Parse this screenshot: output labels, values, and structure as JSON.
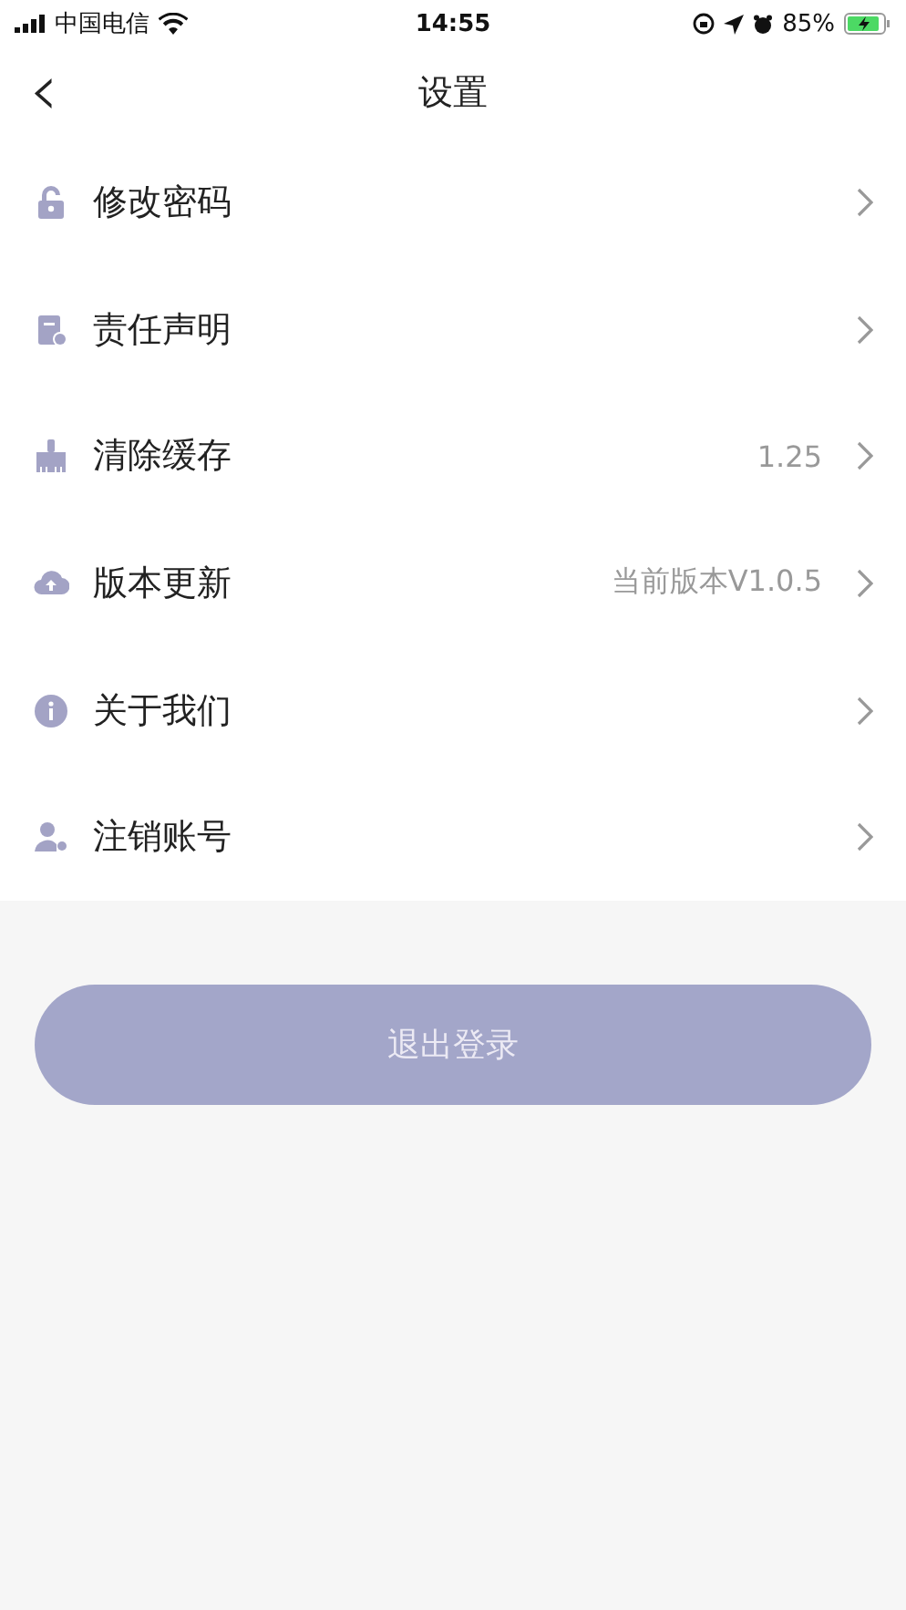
{
  "status_bar": {
    "carrier": "中国电信",
    "time": "14:55",
    "battery": "85%"
  },
  "header": {
    "back": "‹",
    "title": "设置"
  },
  "items": [
    {
      "kind": "lock",
      "label": "修改密码"
    },
    {
      "kind": "document",
      "label": "责任声明"
    },
    {
      "kind": "brush",
      "label": "清除缓存",
      "value": "1.25"
    },
    {
      "kind": "cloud",
      "label": "版本更新",
      "value": "当前版本V1.0.5"
    },
    {
      "kind": "info",
      "label": "关于我们"
    },
    {
      "kind": "user",
      "label": "注销账号"
    }
  ],
  "logout_button": "退出登录"
}
